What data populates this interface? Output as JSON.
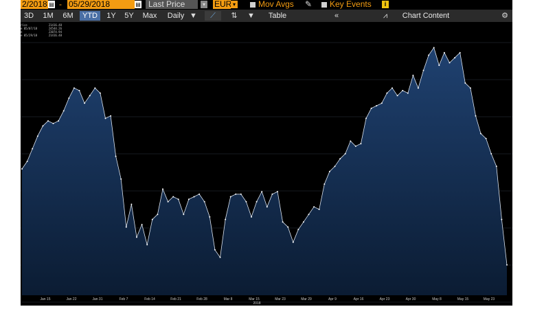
{
  "toolbar": {
    "start_date": "2/2018",
    "dash": "-",
    "end_date": "05/29/2018",
    "field": "Last Price",
    "currency": "EUR",
    "mov_avgs": "Mov Avgs",
    "key_events": "Key Events",
    "info": "i"
  },
  "ranges": [
    "3D",
    "1M",
    "6M",
    "YTD",
    "1Y",
    "5Y",
    "Max"
  ],
  "active_range": "YTD",
  "period": "Daily",
  "table_label": "Table",
  "chart_content_label": "Chart Content",
  "legend": [
    {
      "label": "rice",
      "value": "21416.48"
    },
    {
      "label": "e 05/07/18",
      "value": "24544.26"
    },
    {
      "label": "e",
      "value": "23074.94"
    },
    {
      "label": "e 05/29/18",
      "value": "21416.48"
    }
  ],
  "icons": {
    "calendar": "calendar-icon",
    "dropdown": "dropdown-arrow-icon",
    "pencil": "pencil-icon",
    "chart_type": "line-chart-icon",
    "compare": "compare-icon",
    "collapse": "double-chevron-left-icon",
    "chart_content": "chart-content-icon",
    "settings": "gear-icon"
  },
  "colors": {
    "accent": "#f39c12",
    "line": "#dbe4f0",
    "fill_top": "#1f4170",
    "fill_bottom": "#0b1c33",
    "active_tab": "#4a6fa5"
  },
  "chart_data": {
    "type": "area",
    "year_label": "2018",
    "x_tick_labels": [
      "Jan 15",
      "Jan 22",
      "Jan 31",
      "Feb 7",
      "Feb 14",
      "Feb 21",
      "Feb 28",
      "Mar 8",
      "Mar 15",
      "Mar 23",
      "Mar 29",
      "Apr 9",
      "Apr 16",
      "Apr 23",
      "Apr 30",
      "May 8",
      "May 15",
      "May 23"
    ],
    "ylim": [
      0,
      100
    ],
    "values": [
      50,
      53,
      58,
      63,
      67,
      69,
      68,
      69,
      73,
      78,
      82,
      81,
      76,
      79,
      82,
      80,
      70,
      71,
      55,
      46,
      27,
      36,
      23,
      28,
      20,
      30,
      32,
      42,
      37,
      39,
      38,
      32,
      38,
      39,
      40,
      37,
      31,
      18,
      15,
      30,
      39,
      40,
      40,
      37,
      31,
      37,
      41,
      35,
      40,
      41,
      29,
      27,
      21,
      26,
      29,
      32,
      35,
      34,
      44,
      49,
      51,
      54,
      56,
      61,
      59,
      60,
      70,
      74,
      75,
      76,
      80,
      82,
      79,
      81,
      80,
      87,
      82,
      89,
      95,
      98,
      91,
      96,
      92,
      94,
      96,
      84,
      82,
      71,
      64,
      62,
      56,
      51,
      30,
      12
    ],
    "grid": true,
    "legend": "top-left"
  }
}
